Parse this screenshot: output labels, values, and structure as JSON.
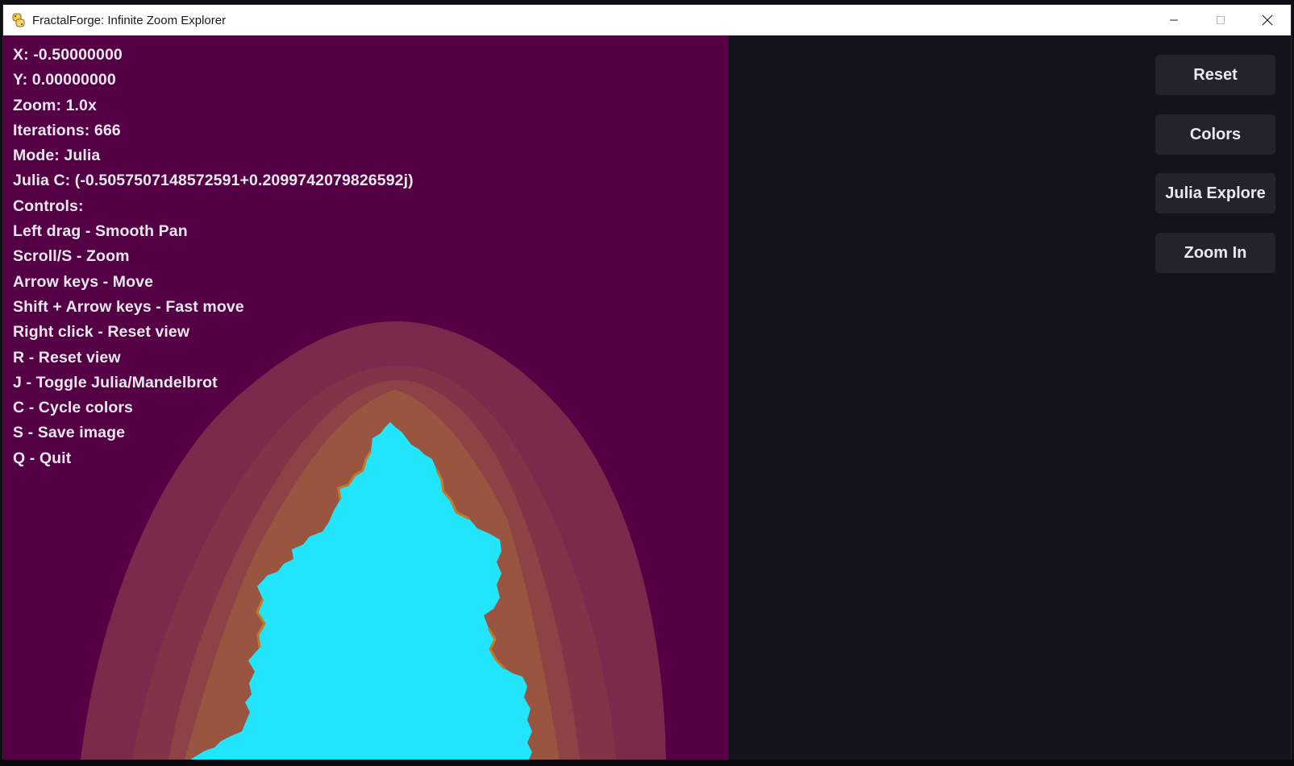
{
  "window": {
    "title": "FractalForge: Infinite Zoom Explorer",
    "icon": "python-snake-icon",
    "controls": [
      "minimize-icon",
      "maximize-icon",
      "close-icon"
    ]
  },
  "info": {
    "x": "X: -0.50000000",
    "y": "Y: 0.00000000",
    "zoom": "Zoom: 1.0x",
    "iterations": "Iterations: 666",
    "mode": "Mode: Julia",
    "julia_c": "Julia C: (-0.5057507148572591+0.2099742079826592j)",
    "controls_header": "Controls:",
    "controls": [
      "Left drag - Smooth Pan",
      "Scroll/S - Zoom",
      "Arrow keys - Move",
      "Shift + Arrow keys - Fast move",
      "Right click - Reset view",
      "R - Reset view",
      "J - Toggle Julia/Mandelbrot",
      "C - Cycle colors",
      "S - Save image",
      "Q - Quit"
    ]
  },
  "buttons": {
    "reset": "Reset",
    "colors": "Colors",
    "julia_explore": "Julia Explore",
    "zoom_in": "Zoom In"
  },
  "colors": {
    "background": "#550044",
    "fractal_core": "#22e4fa",
    "band_outer": "#7a2a4a",
    "band_mid": "#8a3d48",
    "band_inner": "#a05a3c",
    "panel": "#12131b",
    "button": "#21232d"
  }
}
